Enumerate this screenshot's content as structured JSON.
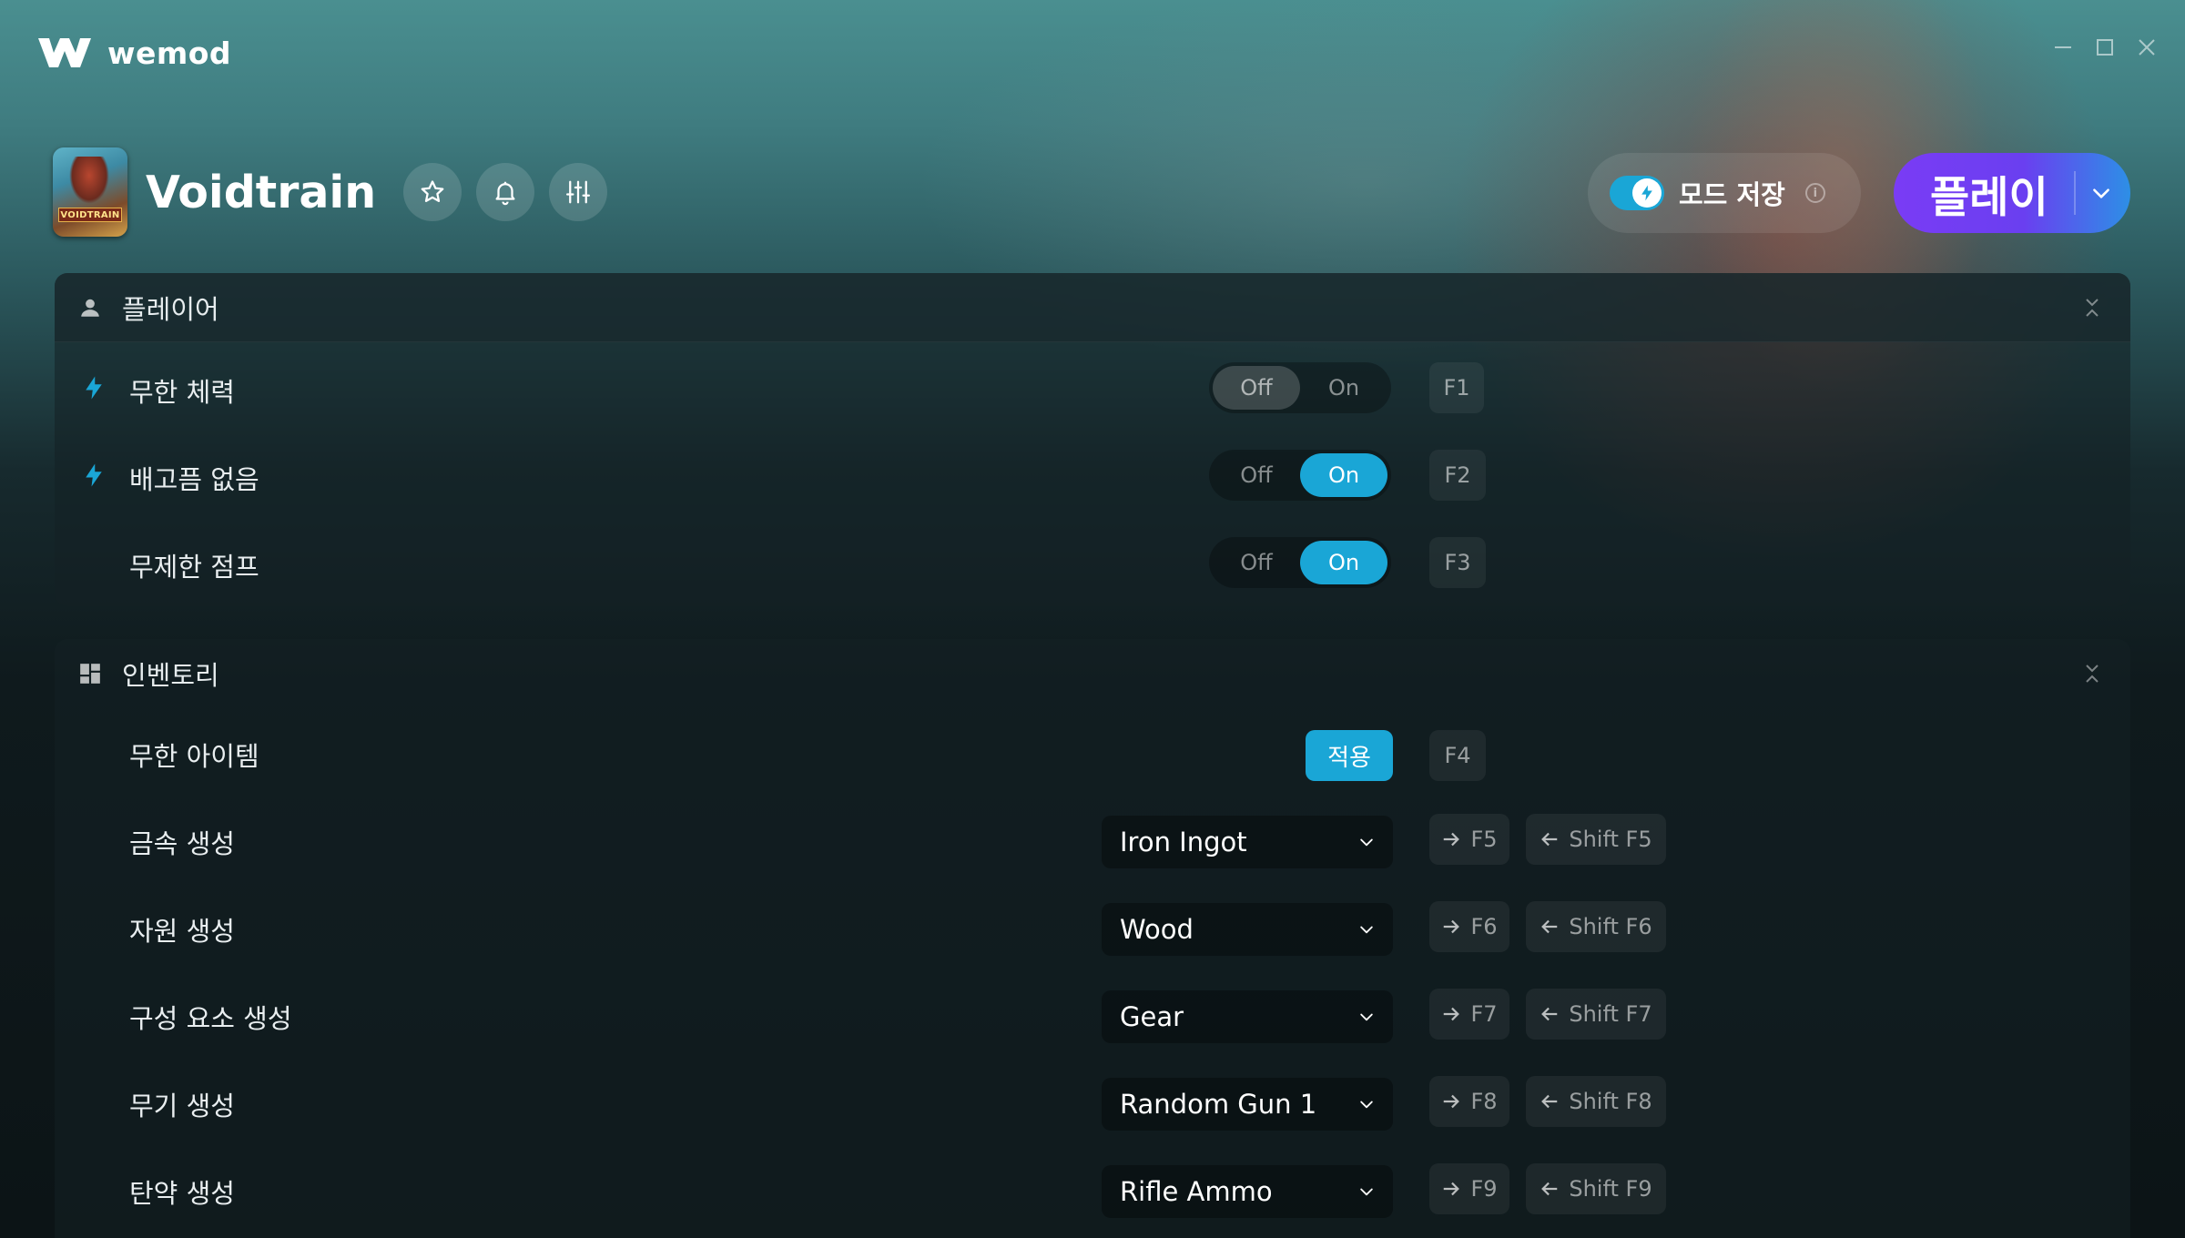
{
  "app": {
    "name": "wemod"
  },
  "game": {
    "title": "Voidtrain",
    "thumb_text": "VOIDTRAIN"
  },
  "header": {
    "save_mods_label": "모드 저장",
    "info_glyph": "i",
    "play_label": "플레이"
  },
  "sections": {
    "player": {
      "title": "플레이어",
      "rows": [
        {
          "label": "무한 체력",
          "off": "Off",
          "on": "On",
          "state": "off",
          "key": "F1"
        },
        {
          "label": "배고픔 없음",
          "off": "Off",
          "on": "On",
          "state": "on",
          "key": "F2"
        },
        {
          "label": "무제한 점프",
          "off": "Off",
          "on": "On",
          "state": "on",
          "key": "F3"
        }
      ]
    },
    "inventory": {
      "title": "인벤토리",
      "apply_row": {
        "label": "무한 아이템",
        "button": "적용",
        "key": "F4"
      },
      "rows": [
        {
          "label": "금속 생성",
          "value": "Iron Ingot",
          "next_key": "F5",
          "prev_key": "Shift F5"
        },
        {
          "label": "자원 생성",
          "value": "Wood",
          "next_key": "F6",
          "prev_key": "Shift F6"
        },
        {
          "label": "구성 요소 생성",
          "value": "Gear",
          "next_key": "F7",
          "prev_key": "Shift F7"
        },
        {
          "label": "무기 생성",
          "value": "Random Gun 1",
          "next_key": "F8",
          "prev_key": "Shift F8"
        },
        {
          "label": "탄약 생성",
          "value": "Rifle Ammo",
          "next_key": "F9",
          "prev_key": "Shift F9"
        }
      ]
    }
  },
  "colors": {
    "accent": "#1aa6d6",
    "play_start": "#7a3cf5",
    "play_end": "#2d8fe6"
  },
  "icons": {
    "logo": "wemod-logo-icon",
    "minimize": "minimize-icon",
    "maximize": "maximize-icon",
    "close": "close-icon",
    "favorite": "star-icon",
    "notify": "bell-icon",
    "settings": "sliders-icon",
    "save": "bolt-icon",
    "player_section": "user-icon",
    "inventory_section": "grid-icon",
    "hotkey_row": "bolt-icon"
  }
}
